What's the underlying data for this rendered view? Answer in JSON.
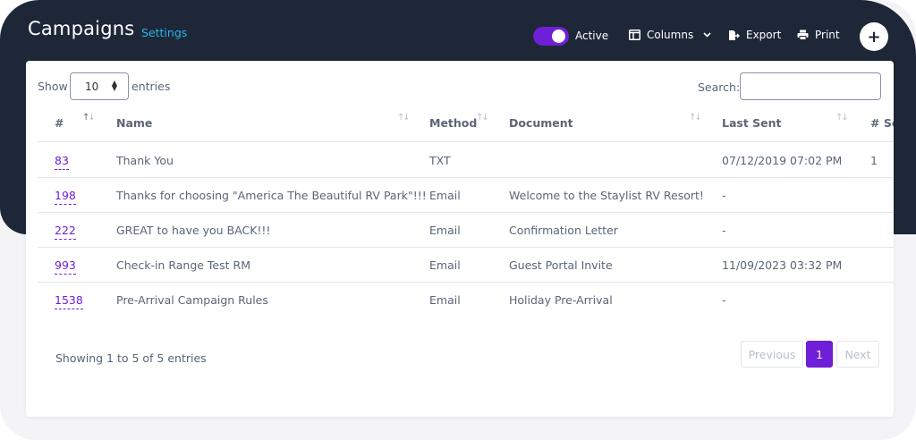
{
  "header": {
    "title": "Campaigns",
    "settings_link": "Settings",
    "active_toggle": {
      "label": "Active",
      "on": true
    },
    "columns_label": "Columns",
    "export_label": "Export",
    "print_label": "Print",
    "add_label": "+"
  },
  "controls": {
    "show_label": "Show",
    "page_size": "10",
    "entries_label": "entries",
    "search_label": "Search:",
    "search_value": ""
  },
  "table": {
    "columns": [
      "#",
      "Name",
      "Method",
      "Document",
      "Last Sent",
      "# Se"
    ],
    "rows": [
      {
        "id": "83",
        "name": "Thank You",
        "method": "TXT",
        "document": "",
        "last_sent": "07/12/2019 07:02 PM",
        "sent": "1"
      },
      {
        "id": "198",
        "name": "Thanks for choosing \"America The Beautiful RV Park\"!!!",
        "method": "Email",
        "document": "Welcome to the Staylist RV Resort!",
        "last_sent": "-",
        "sent": ""
      },
      {
        "id": "222",
        "name": "GREAT to have you BACK!!!",
        "method": "Email",
        "document": "Confirmation Letter",
        "last_sent": "-",
        "sent": ""
      },
      {
        "id": "993",
        "name": "Check-in Range Test RM",
        "method": "Email",
        "document": "Guest Portal Invite",
        "last_sent": "11/09/2023 03:32 PM",
        "sent": ""
      },
      {
        "id": "1538",
        "name": "Pre-Arrival Campaign Rules",
        "method": "Email",
        "document": "Holiday Pre-Arrival",
        "last_sent": "-",
        "sent": ""
      }
    ]
  },
  "footer": {
    "info": "Showing 1 to 5 of 5 entries",
    "previous": "Previous",
    "current_page": "1",
    "next": "Next"
  },
  "colors": {
    "header_bg": "#1e2738",
    "accent": "#6f1fd8",
    "link": "#28b6e8"
  },
  "icons": [
    "columns-icon",
    "chevron-down-icon",
    "export-icon",
    "print-icon",
    "plus-icon",
    "sort-icon",
    "select-caret-icon"
  ]
}
